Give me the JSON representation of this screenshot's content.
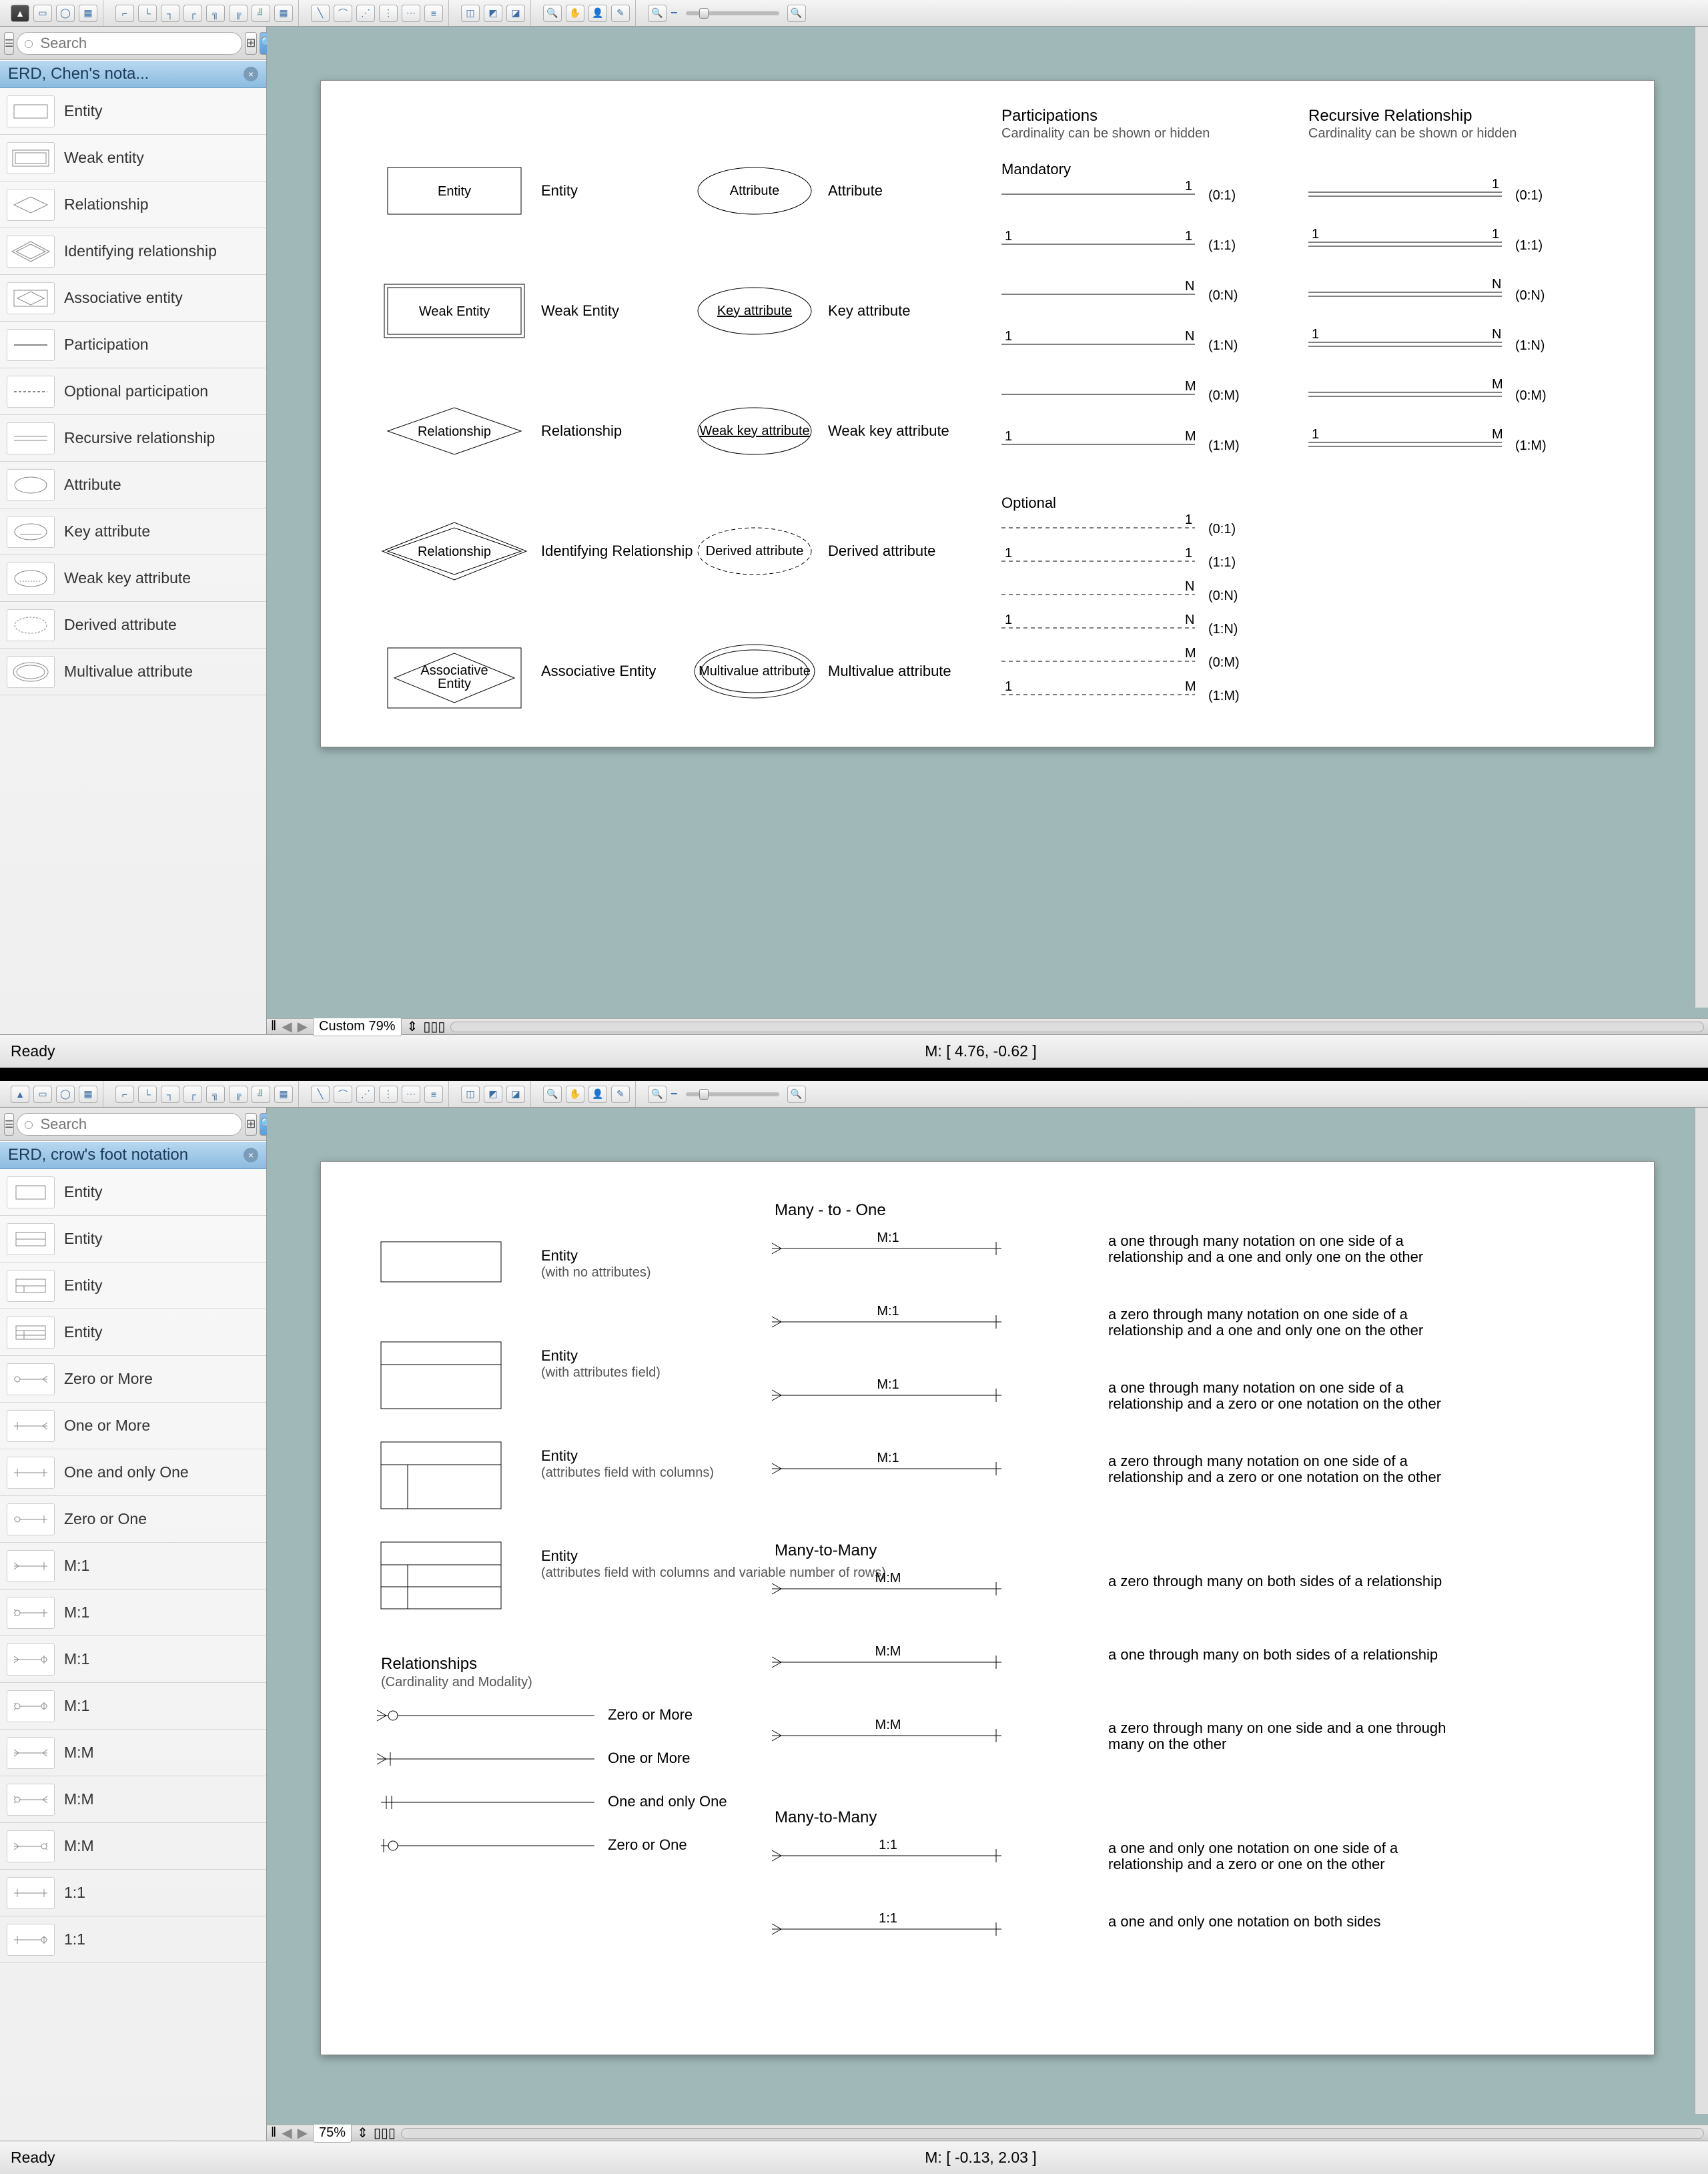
{
  "window1": {
    "search_placeholder": "Search",
    "panel_title": "ERD, Chen's nota...",
    "stencils": [
      "Entity",
      "Weak entity",
      "Relationship",
      "Identifying relationship",
      "Associative entity",
      "Participation",
      "Optional participation",
      "Recursive relationship",
      "Attribute",
      "Key attribute",
      "Weak key attribute",
      "Derived attribute",
      "Multivalue attribute"
    ],
    "zoom": "Custom 79%",
    "status": "Ready",
    "mouse": "M: [ 4.76, -0.62 ]",
    "hscroll_btns": [
      "◀",
      "▶"
    ],
    "diagram": {
      "col1": [
        {
          "shape": "Entity",
          "label": "Entity"
        },
        {
          "shape": "Weak Entity",
          "label": "Weak Entity"
        },
        {
          "shape": "Relationship",
          "label": "Relationship"
        },
        {
          "shape": "Relationship",
          "label": "Identifying Relationship"
        },
        {
          "shape": "Associative Entity",
          "label": "Associative Entity"
        }
      ],
      "col2": [
        {
          "shape": "Attribute",
          "label": "Attribute"
        },
        {
          "shape": "Key attribute",
          "label": "Key attribute"
        },
        {
          "shape": "Weak key attribute",
          "label": "Weak key attribute"
        },
        {
          "shape": "Derived attribute",
          "label": "Derived attribute"
        },
        {
          "shape": "Multivalue attribute",
          "label": "Multivalue attribute"
        }
      ],
      "participations_title": "Participations",
      "recursive_title": "Recursive Relationship",
      "card_sub": "Cardinality can be shown or hidden",
      "mandatory_title": "Mandatory",
      "optional_title": "Optional",
      "mand_rows": [
        {
          "l": "",
          "r": "1",
          "lbl": "(0:1)"
        },
        {
          "l": "1",
          "r": "1",
          "lbl": "(1:1)"
        },
        {
          "l": "",
          "r": "N",
          "lbl": "(0:N)"
        },
        {
          "l": "1",
          "r": "N",
          "lbl": "(1:N)"
        },
        {
          "l": "",
          "r": "M",
          "lbl": "(0:M)"
        },
        {
          "l": "1",
          "r": "M",
          "lbl": "(1:M)"
        }
      ],
      "opt_rows": [
        {
          "l": "",
          "r": "1",
          "lbl": "(0:1)"
        },
        {
          "l": "1",
          "r": "1",
          "lbl": "(1:1)"
        },
        {
          "l": "",
          "r": "N",
          "lbl": "(0:N)"
        },
        {
          "l": "1",
          "r": "N",
          "lbl": "(1:N)"
        },
        {
          "l": "",
          "r": "M",
          "lbl": "(0:M)"
        },
        {
          "l": "1",
          "r": "M",
          "lbl": "(1:M)"
        }
      ]
    }
  },
  "window2": {
    "search_placeholder": "Search",
    "panel_title": "ERD, crow's foot notation",
    "stencils": [
      "Entity",
      "Entity",
      "Entity",
      "Entity",
      "Zero or More",
      "One or More",
      "One and only One",
      "Zero or One",
      "M:1",
      "M:1",
      "M:1",
      "M:1",
      "M:M",
      "M:M",
      "M:M",
      "1:1",
      "1:1"
    ],
    "zoom": "75%",
    "status": "Ready",
    "mouse": "M: [ -0.13, 2.03 ]",
    "diagram": {
      "entities": [
        {
          "title": "Entity",
          "sub": "(with no attributes)"
        },
        {
          "title": "Entity",
          "sub": "(with attributes field)"
        },
        {
          "title": "Entity",
          "sub": "(attributes field with columns)"
        },
        {
          "title": "Entity",
          "sub": "(attributes field with columns and variable number of rows)"
        }
      ],
      "rel_title": "Relationships",
      "rel_sub": "(Cardinality and Modality)",
      "rel_rows": [
        "Zero or More",
        "One or More",
        "One and only One",
        "Zero or One"
      ],
      "sections": [
        {
          "title": "Many - to - One",
          "rows": [
            {
              "c": "M:1",
              "d": "a one through many notation on one side of a relationship and a one and only one on the other"
            },
            {
              "c": "M:1",
              "d": "a zero through many notation on one side of a relationship and a one and only one on the other"
            },
            {
              "c": "M:1",
              "d": "a one through many notation on one side of a relationship and a zero or one notation on the other"
            },
            {
              "c": "M:1",
              "d": "a zero through many notation on one side of a relationship and a zero or one notation on the other"
            }
          ]
        },
        {
          "title": "Many-to-Many",
          "rows": [
            {
              "c": "M:M",
              "d": "a zero through many on both sides of a relationship"
            },
            {
              "c": "M:M",
              "d": "a one through many on both sides of a relationship"
            },
            {
              "c": "M:M",
              "d": "a zero through many on one side and a one through many on the other"
            }
          ]
        },
        {
          "title": "Many-to-Many",
          "rows": [
            {
              "c": "1:1",
              "d": "a one and only one notation on one side of a relationship and a zero or one on the other"
            },
            {
              "c": "1:1",
              "d": "a one and only one notation on both sides"
            }
          ]
        }
      ]
    }
  }
}
